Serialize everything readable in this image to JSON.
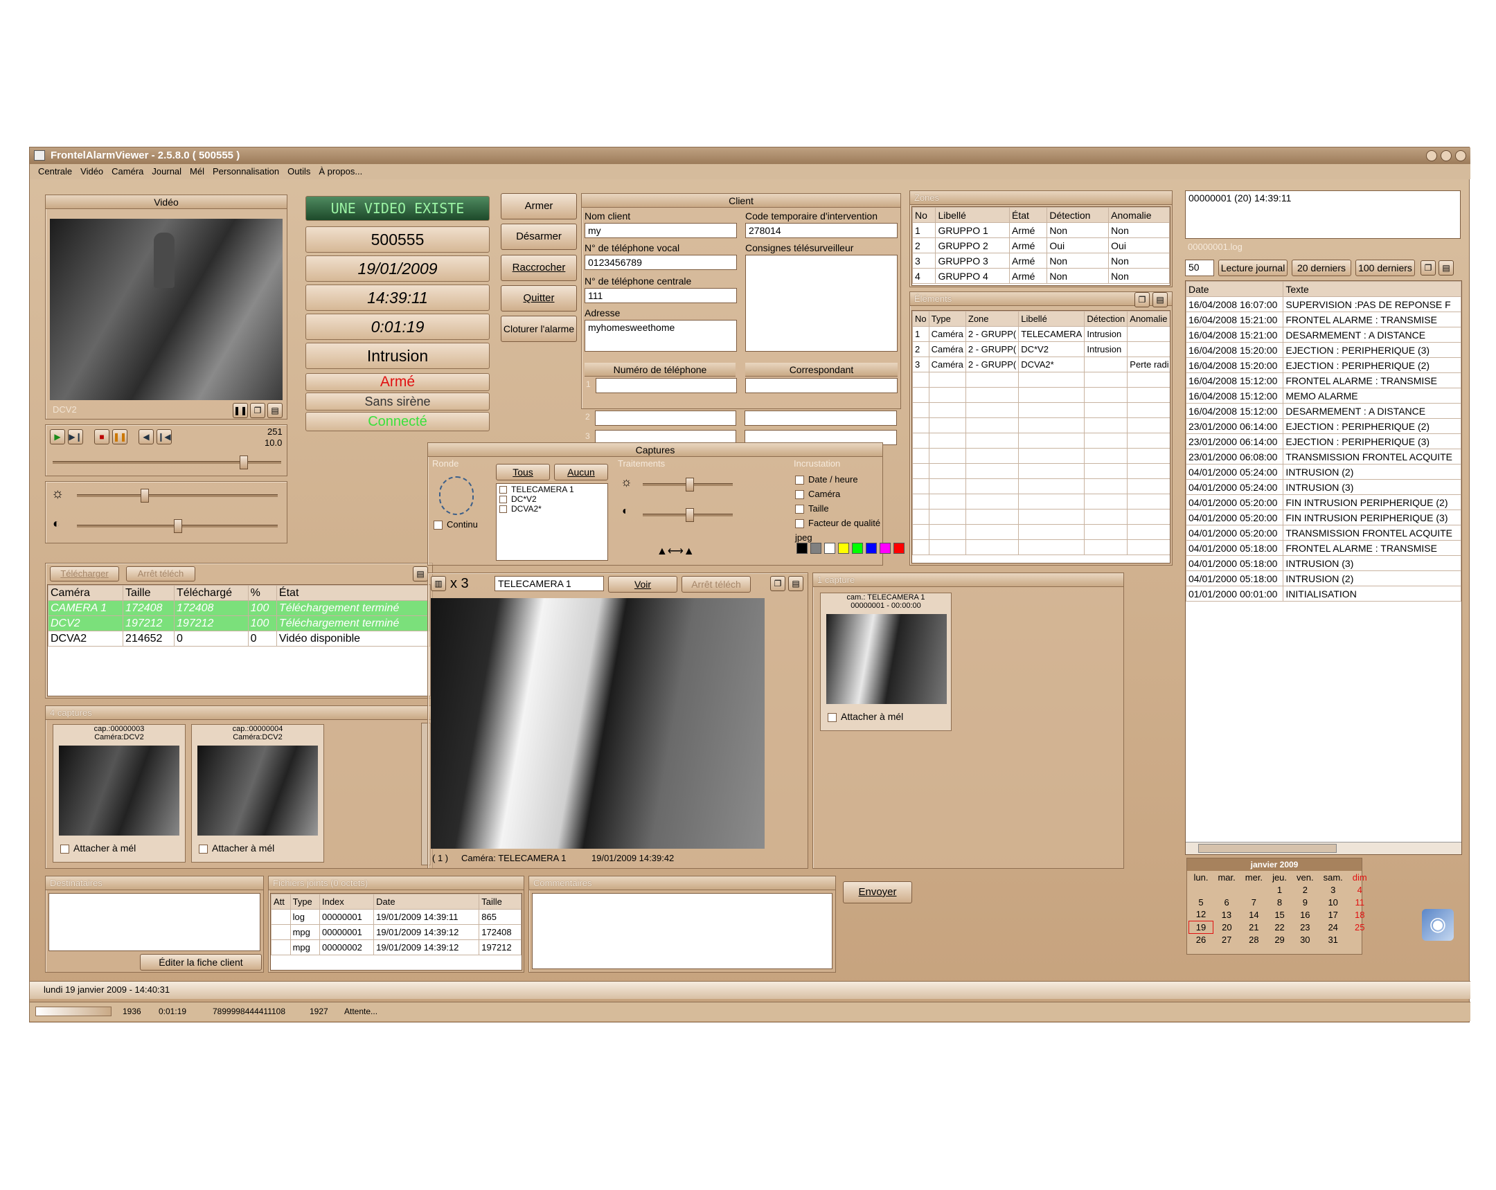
{
  "app": {
    "title": "FrontelAlarmViewer - 2.5.8.0 ( 500555 )"
  },
  "menu": [
    "Centrale",
    "Vidéo",
    "Caméra",
    "Journal",
    "Mél",
    "Personnalisation",
    "Outils",
    "À propos..."
  ],
  "video": {
    "header": "Vidéo",
    "camera_label": "DCV2",
    "counter_top": "251",
    "counter_bottom": "10.0"
  },
  "status": {
    "banner": "UNE VIDEO EXISTE",
    "id": "500555",
    "date": "19/01/2009",
    "time": "14:39:11",
    "duration": "0:01:19",
    "event": "Intrusion",
    "state": "Armé",
    "siren": "Sans sirène",
    "connection": "Connecté"
  },
  "actions": {
    "arm": "Armer",
    "disarm": "Désarmer",
    "hangup": "Raccrocher",
    "quit": "Quitter",
    "close_alarm": "Cloturer l'alarme"
  },
  "client": {
    "header": "Client",
    "name_label": "Nom client",
    "name": "my",
    "code_label": "Code temporaire d'intervention",
    "code": "278014",
    "voice_label": "N° de téléphone vocal",
    "voice": "0123456789",
    "instr_label": "Consignes télésurveilleur",
    "central_label": "N° de téléphone centrale",
    "central": "111",
    "address_label": "Adresse",
    "address": "myhomesweethome",
    "phone_col": "Numéro de téléphone",
    "contact_col": "Correspondant",
    "rows": [
      "1",
      "2",
      "3"
    ]
  },
  "zones": {
    "header": "Zones",
    "columns": [
      "No",
      "Libellé",
      "État",
      "Détection",
      "Anomalie"
    ],
    "rows": [
      [
        "1",
        "GRUPPO  1",
        "Armé",
        "Non",
        "Non"
      ],
      [
        "2",
        "GRUPPO  2",
        "Armé",
        "Oui",
        "Oui"
      ],
      [
        "3",
        "GRUPPO  3",
        "Armé",
        "Non",
        "Non"
      ],
      [
        "4",
        "GRUPPO  4",
        "Armé",
        "Non",
        "Non"
      ]
    ]
  },
  "elements": {
    "header": "Éléments",
    "columns": [
      "No",
      "Type",
      "Zone",
      "Libellé",
      "Détection",
      "Anomalie"
    ],
    "rows": [
      [
        "1",
        "Caméra",
        "2 - GRUPP(",
        "TELECAMERA",
        "Intrusion",
        ""
      ],
      [
        "2",
        "Caméra",
        "2 - GRUPP(",
        "DC*V2",
        "Intrusion",
        ""
      ],
      [
        "3",
        "Caméra",
        "2 - GRUPP(",
        "DCVA2*",
        "",
        "Perte radi"
      ]
    ]
  },
  "journal": {
    "top_text": "00000001 (20)  14:39:11",
    "file_label": "00000001.log",
    "count": "50",
    "read_btn": "Lecture journal",
    "last20": "20 derniers",
    "last100": "100 derniers",
    "columns": [
      "Date",
      "Texte"
    ],
    "rows": [
      [
        "16/04/2008 16:07:00",
        "SUPERVISION :PAS DE REPONSE F"
      ],
      [
        "16/04/2008 15:21:00",
        "FRONTEL ALARME    : TRANSMISE"
      ],
      [
        "16/04/2008 15:21:00",
        "DESARMEMENT     : A DISTANCE"
      ],
      [
        "16/04/2008 15:20:00",
        "EJECTION : PERIPHERIQUE (3)"
      ],
      [
        "16/04/2008 15:20:00",
        "EJECTION : PERIPHERIQUE (2)"
      ],
      [
        "16/04/2008 15:12:00",
        "FRONTEL ALARME    : TRANSMISE"
      ],
      [
        "16/04/2008 15:12:00",
        "MEMO ALARME"
      ],
      [
        "16/04/2008 15:12:00",
        "DESARMEMENT     : A DISTANCE"
      ],
      [
        "23/01/2000 06:14:00",
        "EJECTION : PERIPHERIQUE (2)"
      ],
      [
        "23/01/2000 06:14:00",
        "EJECTION : PERIPHERIQUE (3)"
      ],
      [
        "23/01/2000 06:08:00",
        "TRANSMISSION FRONTEL ACQUITE"
      ],
      [
        "04/01/2000 05:24:00",
        "INTRUSION (2)"
      ],
      [
        "04/01/2000 05:24:00",
        "INTRUSION (3)"
      ],
      [
        "04/01/2000 05:20:00",
        "FIN INTRUSION PERIPHERIQUE (2)"
      ],
      [
        "04/01/2000 05:20:00",
        "FIN INTRUSION PERIPHERIQUE (3)"
      ],
      [
        "04/01/2000 05:20:00",
        "TRANSMISSION FRONTEL ACQUITE"
      ],
      [
        "04/01/2000 05:18:00",
        "FRONTEL ALARME    : TRANSMISE"
      ],
      [
        "04/01/2000 05:18:00",
        "INTRUSION (3)"
      ],
      [
        "04/01/2000 05:18:00",
        "INTRUSION (2)"
      ],
      [
        "01/01/2000 00:01:00",
        "INITIALISATION"
      ]
    ]
  },
  "calendar": {
    "title": "janvier 2009",
    "days": [
      "lun.",
      "mar.",
      "mer.",
      "jeu.",
      "ven.",
      "sam.",
      "dim"
    ],
    "weeks": [
      [
        "",
        "",
        "",
        "1",
        "2",
        "3",
        "4"
      ],
      [
        "5",
        "6",
        "7",
        "8",
        "9",
        "10",
        "11"
      ],
      [
        "12",
        "13",
        "14",
        "15",
        "16",
        "17",
        "18"
      ],
      [
        "19",
        "20",
        "21",
        "22",
        "23",
        "24",
        "25"
      ],
      [
        "26",
        "27",
        "28",
        "29",
        "30",
        "31",
        ""
      ]
    ]
  },
  "captures": {
    "header": "Captures",
    "ronde": "Ronde",
    "all": "Tous",
    "none": "Aucun",
    "continuous": "Continu",
    "cameras": [
      "TELECAMERA 1",
      "DC*V2",
      "DCVA2*"
    ],
    "treatments": "Traitements",
    "overlay": "Incrustation",
    "overlay_opts": [
      "Date / heure",
      "Caméra",
      "Taille",
      "Facteur de qualité jpeg"
    ],
    "colors": [
      "#000000",
      "#808080",
      "#ffffff",
      "#ffff00",
      "#00ff00",
      "#0000ff",
      "#ff00ff",
      "#ff0000"
    ]
  },
  "downloads": {
    "download": "Télécharger",
    "stop": "Arrêt téléch",
    "columns": [
      "Caméra",
      "Taille",
      "Téléchargé",
      "%",
      "État"
    ],
    "rows": [
      [
        "CAMERA  1",
        "172408",
        "172408",
        "100",
        "Téléchargement terminé"
      ],
      [
        "DCV2",
        "197212",
        "197212",
        "100",
        "Téléchargement terminé"
      ],
      [
        "DCVA2",
        "214652",
        "0",
        "0",
        "Vidéo disponible"
      ]
    ]
  },
  "snapshots": {
    "header": "4 captures",
    "items": [
      {
        "title": "cap.:00000003",
        "sub": "Caméra:DCV2",
        "attach": "Attacher à mél"
      },
      {
        "title": "cap.:00000004",
        "sub": "Caméra:DCV2",
        "attach": "Attacher à mél"
      }
    ]
  },
  "viewer": {
    "zoom": "x 3",
    "camera": "TELECAMERA 1",
    "view": "Voir",
    "stop": "Arrêt téléch",
    "footer_index": "( 1 )",
    "footer_cam": "Caméra: TELECAMERA 1",
    "footer_date": "19/01/2009 14:39:42"
  },
  "capture1": {
    "header": "1 capture",
    "title": "cam.: TELECAMERA 1",
    "sub": "00000001 - 00:00:00",
    "attach": "Attacher à mél"
  },
  "recipients": {
    "header": "Destinataires",
    "edit": "Éditer la fiche client"
  },
  "attachments": {
    "header": "Fichiers joints (0 octets)",
    "columns": [
      "Att",
      "Type",
      "Index",
      "Date",
      "Taille"
    ],
    "rows": [
      [
        "",
        "log",
        "00000001",
        "19/01/2009 14:39:11",
        "865"
      ],
      [
        "",
        "mpg",
        "00000001",
        "19/01/2009 14:39:12",
        "172408"
      ],
      [
        "",
        "mpg",
        "00000002",
        "19/01/2009 14:39:12",
        "197212"
      ]
    ]
  },
  "comments": {
    "header": "Commentaires"
  },
  "send": "Envoyer",
  "footer": {
    "date": "lundi 19 janvier 2009  -  14:40:31",
    "cells": [
      "1936",
      "0:01:19",
      "7899998444411108",
      "1927",
      "Attente..."
    ]
  }
}
